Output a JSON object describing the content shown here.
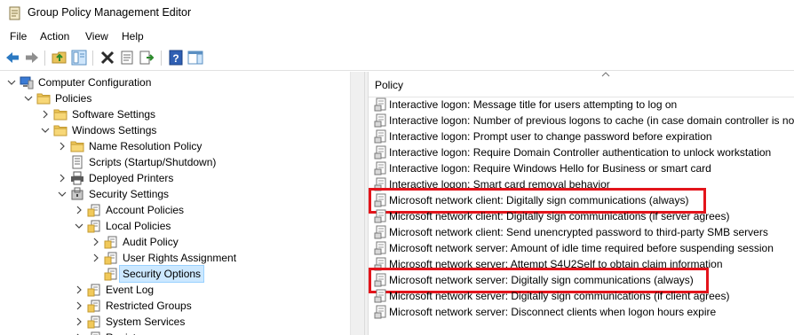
{
  "window": {
    "title": "Group Policy Management Editor",
    "icon": "gpo-editor-icon"
  },
  "menubar": {
    "file": "File",
    "action": "Action",
    "view": "View",
    "help": "Help"
  },
  "toolbar": {
    "buttons": [
      "back-icon",
      "forward-icon",
      "up-folder-icon",
      "show-hide-tree-icon",
      "delete-icon",
      "properties-icon",
      "export-list-icon",
      "help-icon",
      "show-action-pane-icon"
    ]
  },
  "tree": {
    "items": [
      {
        "label": "Computer Configuration",
        "icon": "computer-icon",
        "expanded": true
      },
      {
        "label": "Policies",
        "icon": "folder-icon",
        "expanded": true
      },
      {
        "label": "Software Settings",
        "icon": "folder-icon",
        "expanded": false
      },
      {
        "label": "Windows Settings",
        "icon": "folder-icon",
        "expanded": true
      },
      {
        "label": "Name Resolution Policy",
        "icon": "folder-icon",
        "expanded": false
      },
      {
        "label": "Scripts (Startup/Shutdown)",
        "icon": "script-icon",
        "expanded": false
      },
      {
        "label": "Deployed Printers",
        "icon": "printer-icon",
        "expanded": false
      },
      {
        "label": "Security Settings",
        "icon": "security-settings-icon",
        "expanded": true
      },
      {
        "label": "Account Policies",
        "icon": "policy-folder-icon",
        "expanded": false
      },
      {
        "label": "Local Policies",
        "icon": "policy-folder-icon",
        "expanded": true
      },
      {
        "label": "Audit Policy",
        "icon": "policy-folder-icon",
        "expanded": false
      },
      {
        "label": "User Rights Assignment",
        "icon": "policy-folder-icon",
        "expanded": false
      },
      {
        "label": "Security Options",
        "icon": "policy-folder-icon",
        "selected": true
      },
      {
        "label": "Event Log",
        "icon": "policy-folder-icon",
        "expanded": false
      },
      {
        "label": "Restricted Groups",
        "icon": "policy-folder-icon",
        "expanded": false
      },
      {
        "label": "System Services",
        "icon": "policy-folder-icon",
        "expanded": false
      },
      {
        "label": "Registry",
        "icon": "policy-folder-icon",
        "expanded": false
      }
    ]
  },
  "policy_list": {
    "header": "Policy",
    "rows": [
      {
        "label": "Interactive logon: Message title for users attempting to log on",
        "icon": "policy-setting-icon"
      },
      {
        "label": "Interactive logon: Number of previous logons to cache (in case domain controller is not available)",
        "icon": "policy-setting-icon"
      },
      {
        "label": "Interactive logon: Prompt user to change password before expiration",
        "icon": "policy-setting-icon"
      },
      {
        "label": "Interactive logon: Require Domain Controller authentication to unlock workstation",
        "icon": "policy-setting-icon"
      },
      {
        "label": "Interactive logon: Require Windows Hello for Business or smart card",
        "icon": "policy-setting-icon"
      },
      {
        "label": "Interactive logon: Smart card removal behavior",
        "icon": "policy-setting-icon"
      },
      {
        "label": "Microsoft network client: Digitally sign communications (always)",
        "icon": "policy-setting-icon",
        "highlighted": true
      },
      {
        "label": "Microsoft network client: Digitally sign communications (if server agrees)",
        "icon": "policy-setting-icon"
      },
      {
        "label": "Microsoft network client: Send unencrypted password to third-party SMB servers",
        "icon": "policy-setting-icon"
      },
      {
        "label": "Microsoft network server: Amount of idle time required before suspending session",
        "icon": "policy-setting-icon"
      },
      {
        "label": "Microsoft network server: Attempt S4U2Self to obtain claim information",
        "icon": "policy-setting-icon"
      },
      {
        "label": "Microsoft network server: Digitally sign communications (always)",
        "icon": "policy-setting-icon",
        "highlighted": true
      },
      {
        "label": "Microsoft network server: Digitally sign communications (if client agrees)",
        "icon": "policy-setting-icon"
      },
      {
        "label": "Microsoft network server: Disconnect clients when logon hours expire",
        "icon": "policy-setting-icon"
      }
    ]
  },
  "colors": {
    "highlight_border": "#e3141b",
    "selection": "#cce8ff",
    "folder": "#e8c25a"
  }
}
